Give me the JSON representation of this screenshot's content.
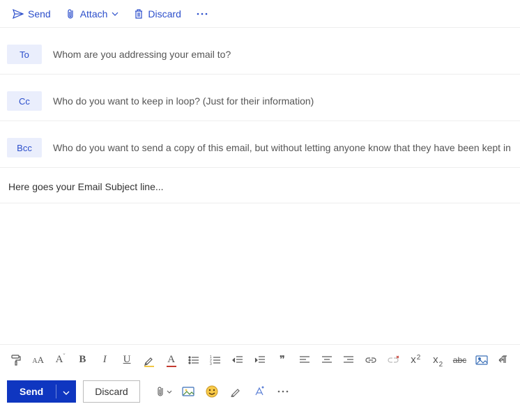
{
  "toolbar": {
    "send": "Send",
    "attach": "Attach",
    "discard": "Discard"
  },
  "recipients": {
    "to_label": "To",
    "to_placeholder": "Whom are you addressing your email to?",
    "cc_label": "Cc",
    "cc_placeholder": "Who do you want to keep in loop? (Just for their information)",
    "bcc_label": "Bcc",
    "bcc_placeholder": "Who do you want to send a copy of this email, but without letting anyone know that they have been kept in this loop?"
  },
  "subject": {
    "value": "Here goes your Email Subject line..."
  },
  "body": {
    "value": ""
  },
  "format": {
    "font_size": "A",
    "font_size_small": "A",
    "font_size_big": "A",
    "bold": "B",
    "italic": "I",
    "underline": "U",
    "font_color": "A",
    "quote": "❝❞",
    "superscript_base": "x",
    "superscript_exp": "2",
    "subscript_base": "x",
    "subscript_exp": "2",
    "strikethrough": "abc"
  },
  "colors": {
    "accent": "#2b4ecb",
    "send_button": "#0f36c0",
    "pill_bg": "#eaeefc",
    "highlight_yellow": "#f2c744",
    "font_color_red": "#c43a2f"
  },
  "bottom": {
    "send": "Send",
    "discard": "Discard"
  }
}
